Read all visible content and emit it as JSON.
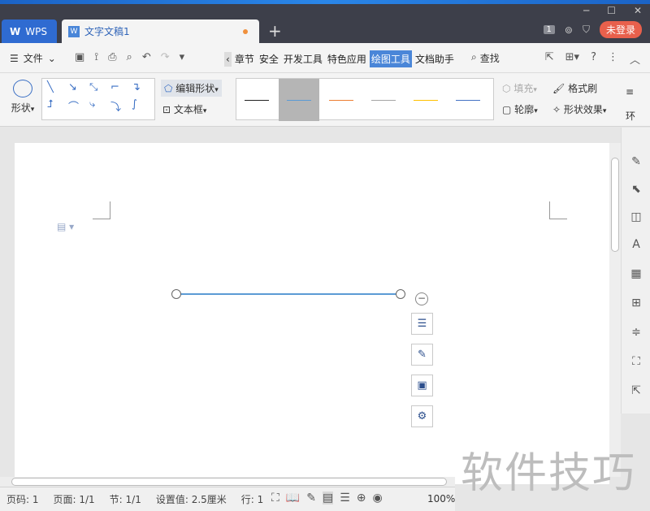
{
  "titlebar": {
    "wps_tab_label": "WPS",
    "doc_tab_label": "文字文稿1",
    "new_tab_symbol": "+",
    "notification_count": "1",
    "login_label": "未登录",
    "minimize_symbol": "─",
    "maximize_symbol": "☐",
    "close_symbol": "✕"
  },
  "menubar": {
    "file_label": "文件",
    "tabs": [
      "章节",
      "安全",
      "开发工具",
      "特色应用",
      "绘图工具",
      "文档助手"
    ],
    "active_tab": "绘图工具",
    "find_label": "查找"
  },
  "ribbon": {
    "shape_label": "形状",
    "edit_shape_label": "编辑形状",
    "textbox_label": "文本框",
    "fill_label": "填充",
    "outline_label": "轮廓",
    "format_brush_label": "格式刷",
    "shape_effects_label": "形状效果",
    "wrap_label": "环",
    "line_style_colors": [
      "#222222",
      "#5b9bd5",
      "#ed7d31",
      "#a5a5a5",
      "#ffc000",
      "#4472c4"
    ]
  },
  "statusbar": {
    "page_num": "页码: 1",
    "pages": "页面: 1/1",
    "section": "节: 1/1",
    "setting": "设置值: 2.5厘米",
    "row": "行: 1",
    "zoom": "100%"
  },
  "watermark": "软件技巧"
}
